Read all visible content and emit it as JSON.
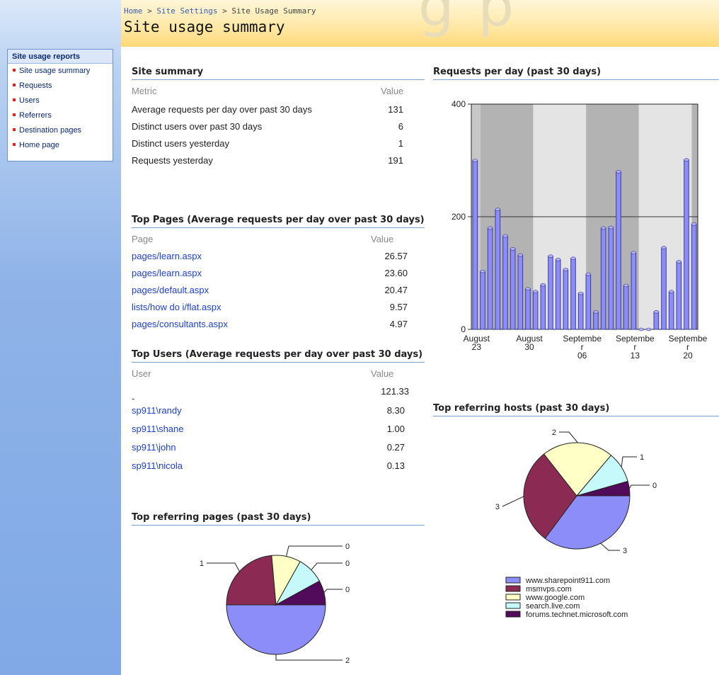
{
  "colors": {
    "bar": "#8d8dfa",
    "accent": "#7d9fd0",
    "link": "#1c3fd0"
  },
  "breadcrumb": {
    "home": "Home",
    "sep": ">",
    "settings": "Site Settings",
    "current": "Site Usage Summary"
  },
  "page_title": "Site usage summary",
  "nav": {
    "heading": "Site usage reports",
    "items": [
      "Site usage summary",
      "Requests",
      "Users",
      "Referrers",
      "Destination pages",
      "Home page"
    ]
  },
  "site_summary": {
    "title": "Site summary",
    "col_metric": "Metric",
    "col_value": "Value",
    "rows": [
      {
        "label": "Average requests per day over past 30 days",
        "value": "131"
      },
      {
        "label": "Distinct users over past 30 days",
        "value": "6"
      },
      {
        "label": "Distinct users yesterday",
        "value": "1"
      },
      {
        "label": "Requests yesterday",
        "value": "191"
      }
    ]
  },
  "top_pages": {
    "title": "Top Pages (Average requests per day over past 30 days)",
    "col_page": "Page",
    "col_value": "Value",
    "rows": [
      {
        "label": "pages/learn.aspx",
        "value": "26.57"
      },
      {
        "label": "pages/learn.aspx",
        "value": "23.60"
      },
      {
        "label": "pages/default.aspx",
        "value": "20.47"
      },
      {
        "label": "lists/how do i/flat.aspx",
        "value": "9.57"
      },
      {
        "label": "pages/consultants.aspx",
        "value": "4.97"
      }
    ]
  },
  "top_users": {
    "title": "Top Users (Average requests per day over past 30 days)",
    "col_user": "User",
    "col_value": "Value",
    "rows": [
      {
        "label": "-",
        "value": "121.33"
      },
      {
        "label": "sp911\\randy",
        "value": "8.30"
      },
      {
        "label": "sp911\\shane",
        "value": "1.00"
      },
      {
        "label": "sp911\\john",
        "value": "0.27"
      },
      {
        "label": "sp911\\nicola",
        "value": "0.13"
      }
    ]
  },
  "referring_pages_title": "Top referring pages (past 30 days)",
  "requests_title": "Requests per day (past 30 days)",
  "referring_hosts_title": "Top referring hosts (past 30 days)",
  "chart_data": [
    {
      "type": "bar",
      "title": "Requests per day (past 30 days)",
      "ylim": [
        0,
        400
      ],
      "yticks": [
        "0",
        "200",
        "400"
      ],
      "xtick_labels": [
        [
          "August",
          "23"
        ],
        [
          "August",
          "30"
        ],
        [
          "Septembe",
          "r",
          "06"
        ],
        [
          "Septembe",
          "r",
          "13"
        ],
        [
          "Septembe",
          "r",
          "20"
        ]
      ],
      "values": [
        300,
        103,
        180,
        213,
        166,
        143,
        132,
        72,
        67,
        79,
        130,
        124,
        106,
        126,
        64,
        98,
        31,
        180,
        181,
        280,
        78,
        136,
        0,
        0,
        31,
        145,
        67,
        120,
        301,
        187
      ],
      "grid": "horizontal"
    },
    {
      "type": "pie",
      "title": "Top referring pages (past 30 days)",
      "slices": [
        {
          "label": "2",
          "value": 0.5,
          "color": "#8d8dfa"
        },
        {
          "label": "1",
          "value": 0.236,
          "color": "#8b2a52"
        },
        {
          "label": "0",
          "value": 0.095,
          "color": "#ffffc6"
        },
        {
          "label": "0",
          "value": 0.089,
          "color": "#c6fafa"
        },
        {
          "label": "0",
          "value": 0.08,
          "color": "#520b5a"
        }
      ]
    },
    {
      "type": "pie",
      "title": "Top referring hosts (past 30 days)",
      "legend_placement": "bottom",
      "slices": [
        {
          "label": "3",
          "value": 0.352,
          "color": "#8d8dfa",
          "legend": "www.sharepoint911.com"
        },
        {
          "label": "3",
          "value": 0.292,
          "color": "#8b2a52",
          "legend": "msmvps.com"
        },
        {
          "label": "2",
          "value": 0.218,
          "color": "#ffffc6",
          "legend": "www.google.com"
        },
        {
          "label": "1",
          "value": 0.094,
          "color": "#c6fafa",
          "legend": "search.live.com"
        },
        {
          "label": "0",
          "value": 0.044,
          "color": "#520b5a",
          "legend": "forums.technet.microsoft.com"
        }
      ]
    }
  ]
}
